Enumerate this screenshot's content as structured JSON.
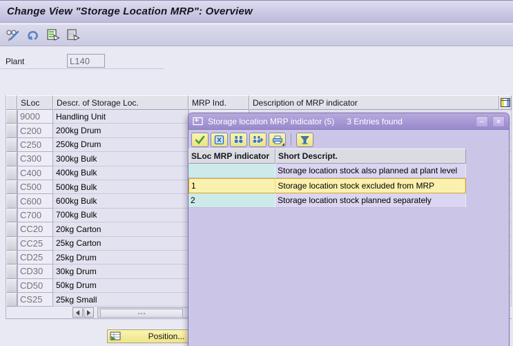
{
  "window": {
    "title": "Change View \"Storage Location MRP\": Overview",
    "toolbar_icons": [
      "display-change-toggle",
      "undo",
      "select-all",
      "deselect-all"
    ]
  },
  "form": {
    "plant_label": "Plant",
    "plant_value": "L140"
  },
  "main_table": {
    "columns": [
      "SLoc",
      "Descr. of Storage Loc.",
      "MRP Ind.",
      "Description of MRP indicator"
    ],
    "config_icon": "table-configuration",
    "rows": [
      {
        "sloc": "9000",
        "descr": "Handling Unit"
      },
      {
        "sloc": "C200",
        "descr": "200kg Drum"
      },
      {
        "sloc": "C250",
        "descr": "250kg Drum"
      },
      {
        "sloc": "C300",
        "descr": "300kg Bulk"
      },
      {
        "sloc": "C400",
        "descr": "400kg Bulk"
      },
      {
        "sloc": "C500",
        "descr": "500kg Bulk"
      },
      {
        "sloc": "C600",
        "descr": "600kg Bulk"
      },
      {
        "sloc": "C700",
        "descr": "700kg Bulk"
      },
      {
        "sloc": "CC20",
        "descr": "20kg Carton"
      },
      {
        "sloc": "CC25",
        "descr": "25kg Carton"
      },
      {
        "sloc": "CD25",
        "descr": "25kg Drum"
      },
      {
        "sloc": "CD30",
        "descr": "30kg Drum"
      },
      {
        "sloc": "CD50",
        "descr": "50kg Drum"
      },
      {
        "sloc": "CS25",
        "descr": "25kg Small"
      }
    ]
  },
  "position_button": {
    "label": "Position..."
  },
  "popup": {
    "title": "Storage location MRP indicator (5)",
    "entries_text": "3 Entries found",
    "toolbar_icons": [
      "continue-check",
      "cancel",
      "find",
      "find-next",
      "print",
      "filter"
    ],
    "columns": [
      "SLoc MRP indicator",
      "Short Descript."
    ],
    "rows": [
      {
        "indicator": "",
        "descr": "Storage location stock also planned at plant level",
        "selected": false
      },
      {
        "indicator": "1",
        "descr": "Storage location stock excluded from MRP",
        "selected": true
      },
      {
        "indicator": "2",
        "descr": "Storage location stock planned separately",
        "selected": false
      }
    ]
  },
  "colors": {
    "body_background": "#E9E9F3",
    "titlebar": "#C9C8E4",
    "popup_titlebar": "#A495D3",
    "popup_body": "#CBC5E7",
    "popup_selected_row": "#FBF1AE",
    "popup_selected_border": "#D4A62C",
    "popup_cyan_cell": "#CCEAE9",
    "popup_lavender_cell": "#DAD5F0",
    "yellow_button": "#F5EDA0"
  }
}
